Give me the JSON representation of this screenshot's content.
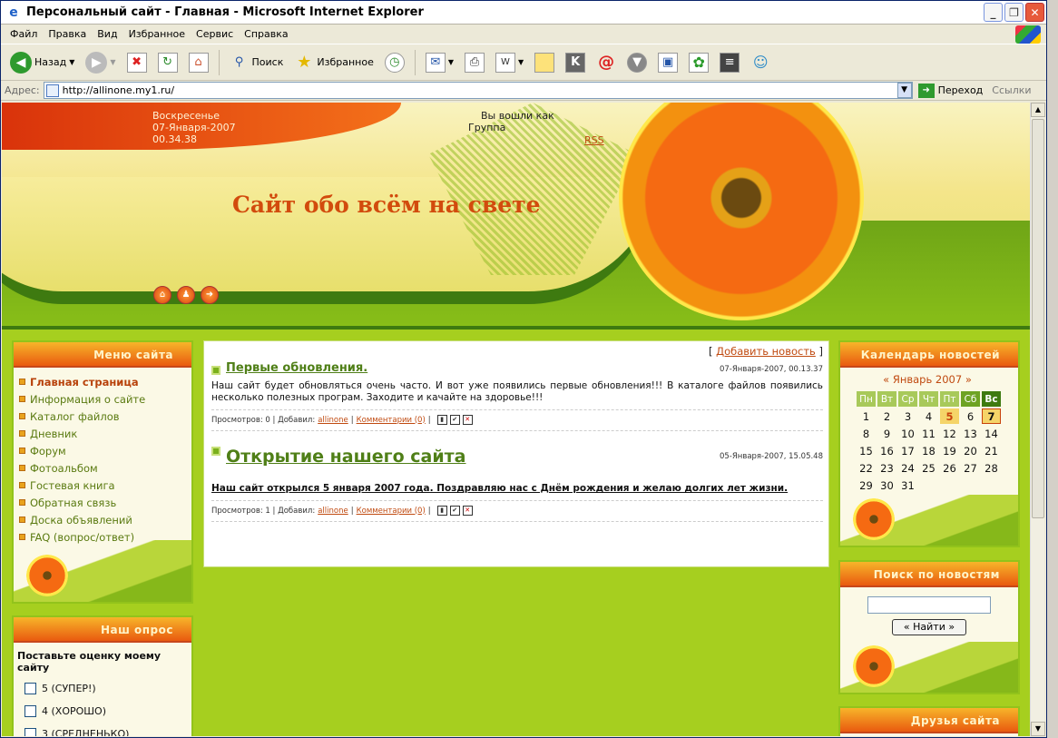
{
  "window": {
    "title": "Персональный сайт - Главная - Microsoft Internet Explorer"
  },
  "menubar": [
    "Файл",
    "Правка",
    "Вид",
    "Избранное",
    "Сервис",
    "Справка"
  ],
  "toolbar": {
    "back": "Назад",
    "search": "Поиск",
    "favorites": "Избранное"
  },
  "address": {
    "label": "Адрес:",
    "url": "http://allinone.my1.ru/",
    "go": "Переход",
    "links": "Ссылки"
  },
  "header": {
    "day": "Воскресенье",
    "date": "07-Января-2007",
    "time": "00.34.38",
    "login_line1": "Вы вошли как",
    "login_line2": "Группа",
    "rss": "RSS",
    "site_name": "Сайт обо всём на свете"
  },
  "menu": {
    "title": "Меню сайта",
    "items": [
      "Главная страница",
      "Информация о сайте",
      "Каталог файлов",
      "Дневник",
      "Форум",
      "Фотоальбом",
      "Гостевая книга",
      "Обратная связь",
      "Доска объявлений",
      "FAQ (вопрос/ответ)"
    ]
  },
  "poll": {
    "title": "Наш опрос",
    "question": "Поставьте оценку моему сайту",
    "options": [
      "5 (СУПЕР!)",
      "4 (ХОРОШО)",
      "3 (СРЕДНЕНЬКО)"
    ]
  },
  "content": {
    "add_news_open": "[",
    "add_news": "Добавить новость",
    "add_news_close": "]",
    "news": [
      {
        "title": "Первые обновления.",
        "date": "07-Января-2007, 00.13.37",
        "body": "Наш сайт будет обновляться очень часто. И вот уже появились первые обновления!!! В каталоге файлов появились несколько полезных програм. Заходите и качайте на здоровье!!!",
        "views": "Просмотров: 0 | Добавил:",
        "author": "allinone",
        "sep": "|",
        "comments": "Комментарии (0)",
        "sep2": "|"
      },
      {
        "title": "Открытие нашего сайта",
        "date": "05-Января-2007, 15.05.48",
        "body": "Наш сайт открылся 5 января 2007 года. Поздравляю нас с Днём рождения и желаю долгих лет жизни.",
        "views": "Просмотров: 1 | Добавил:",
        "author": "allinone",
        "sep": "|",
        "comments": "Комментарии (0)",
        "sep2": "|"
      }
    ]
  },
  "calendar": {
    "title": "Календарь новостей",
    "month": "«  Январь 2007  »",
    "days": [
      "Пн",
      "Вт",
      "Ср",
      "Чт",
      "Пт",
      "Сб",
      "Вс"
    ],
    "weeks": [
      [
        "1",
        "2",
        "3",
        "4",
        "5",
        "6",
        "7"
      ],
      [
        "8",
        "9",
        "10",
        "11",
        "12",
        "13",
        "14"
      ],
      [
        "15",
        "16",
        "17",
        "18",
        "19",
        "20",
        "21"
      ],
      [
        "22",
        "23",
        "24",
        "25",
        "26",
        "27",
        "28"
      ],
      [
        "29",
        "30",
        "31",
        "",
        "",
        "",
        ""
      ]
    ]
  },
  "search": {
    "title": "Поиск по новостям",
    "button": "« Найти »"
  },
  "friends": {
    "title": "Друзья сайта"
  }
}
